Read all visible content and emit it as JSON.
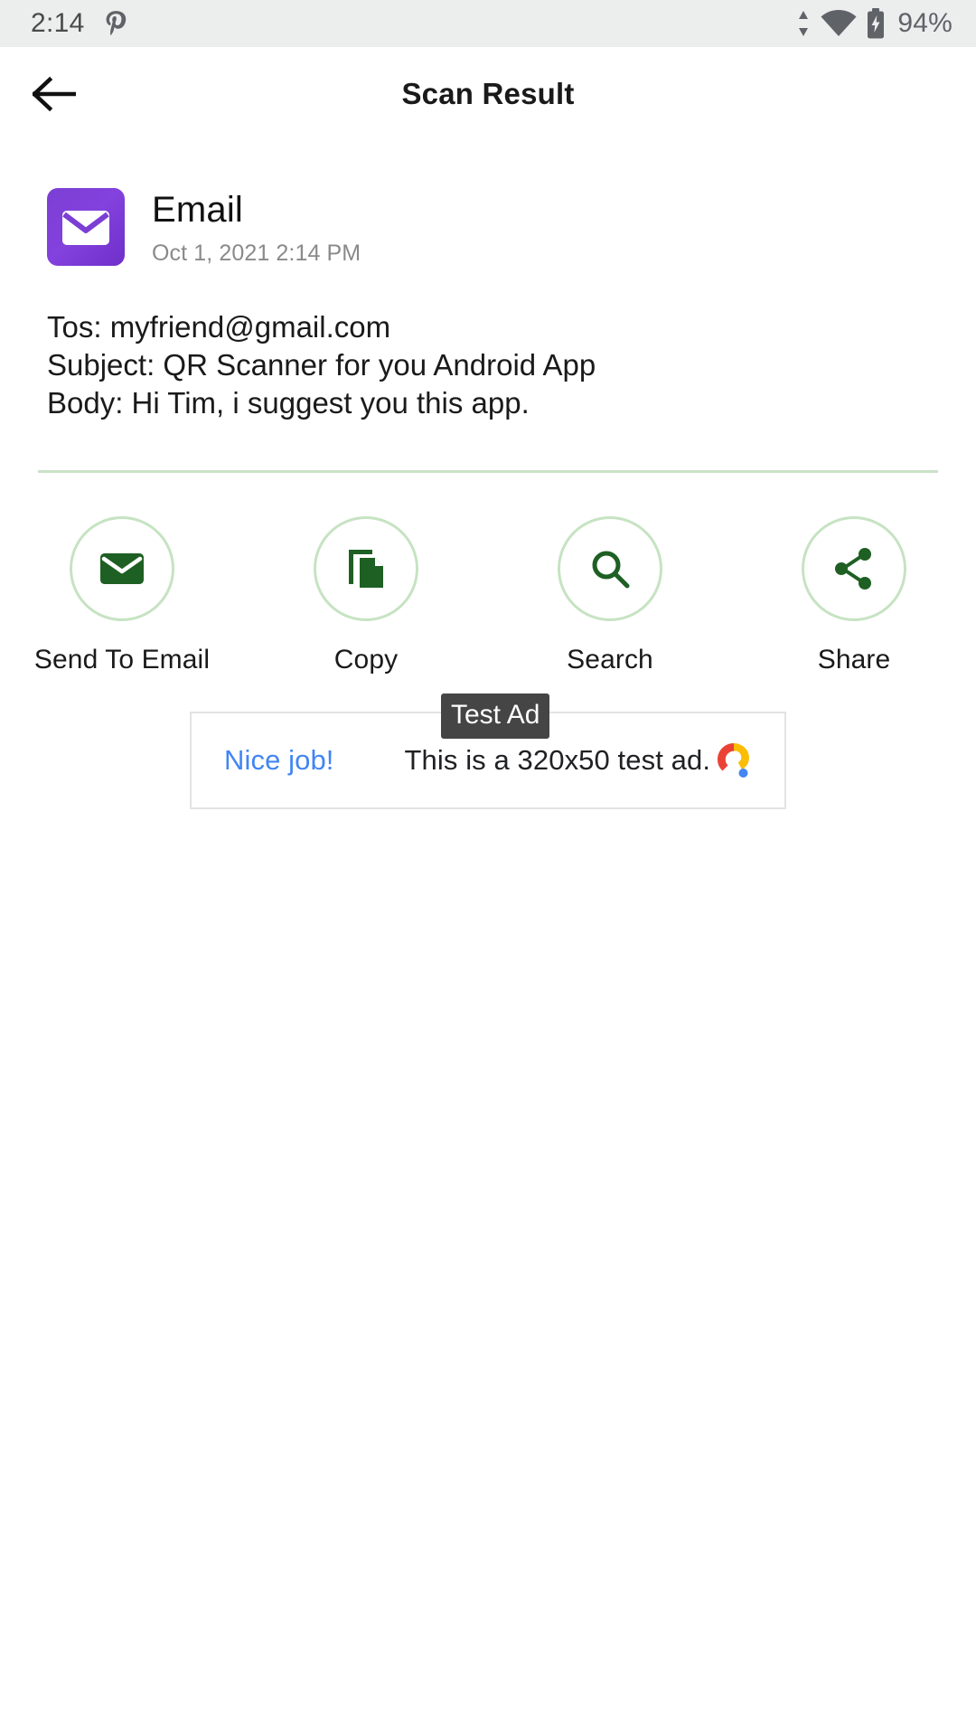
{
  "status_bar": {
    "time": "2:14",
    "notification_icon": "pinterest-icon",
    "sync_icon": "data-transfer-icon",
    "wifi_icon": "wifi-icon",
    "battery_icon": "battery-charging-icon",
    "battery_level": "94%",
    "background": "#eceded",
    "foreground": "#5f6368"
  },
  "app_bar": {
    "back_icon": "back-arrow-icon",
    "title": "Scan Result"
  },
  "result": {
    "type_icon": "email-app-icon",
    "type_icon_color": "#7b3fd4",
    "title": "Email",
    "timestamp": "Oct 1, 2021 2:14 PM",
    "lines": [
      "Tos: myfriend@gmail.com",
      "Subject: QR Scanner for you Android App",
      "Body: Hi Tim, i suggest you this app."
    ]
  },
  "actions": {
    "accent_color": "#1e6023",
    "ring_color": "#c6e3c2",
    "items": [
      {
        "icon": "envelope-icon",
        "label": "Send To Email"
      },
      {
        "icon": "copy-icon",
        "label": "Copy"
      },
      {
        "icon": "search-icon",
        "label": "Search"
      },
      {
        "icon": "share-icon",
        "label": "Share"
      }
    ]
  },
  "ad": {
    "badge": "Test Ad",
    "cta": "Nice job!",
    "body": "This is a 320x50 test ad.",
    "logo": "admob-logo-icon",
    "cta_color": "#4285f4"
  }
}
